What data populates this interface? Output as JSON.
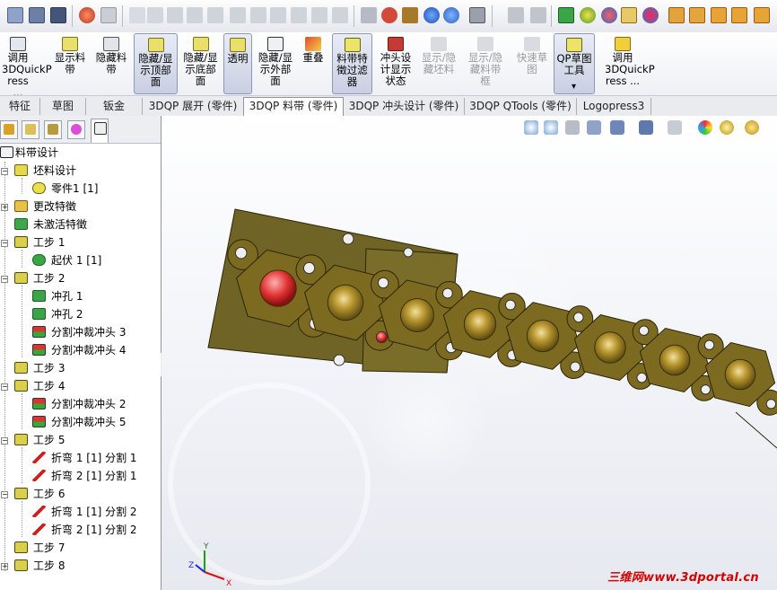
{
  "command_manager": {
    "items": [
      {
        "label": "调用\n3DQuickP\nress ...",
        "state": "normal"
      },
      {
        "label": "显示料\n带",
        "state": "normal"
      },
      {
        "label": "隐藏料\n带",
        "state": "normal"
      },
      {
        "label": "隐藏/显\n示顶部\n面",
        "state": "active"
      },
      {
        "label": "隐藏/显\n示底部\n面",
        "state": "normal"
      },
      {
        "label": "透明",
        "state": "active"
      },
      {
        "label": "隐藏/显\n示外部\n面",
        "state": "normal"
      },
      {
        "label": "重叠",
        "state": "normal"
      },
      {
        "label": "料带特\n徵过滤\n器",
        "state": "active"
      },
      {
        "label": "冲头设\n计显示\n状态",
        "state": "normal"
      },
      {
        "label": "显示/隐\n藏坯料",
        "state": "disabled"
      },
      {
        "label": "显示/隐\n藏料带\n框",
        "state": "disabled"
      },
      {
        "label": "快速草\n图",
        "state": "disabled"
      },
      {
        "label": "QP草图\n工具",
        "state": "active"
      },
      {
        "label": "调用\n3DQuickP\nress ...",
        "state": "normal"
      }
    ],
    "dropdown_arrow": "▾"
  },
  "tabs": [
    "特征",
    "草图",
    "钣金",
    "3DQP 展开 (零件)",
    "3DQP 料带 (零件)",
    "3DQP 冲头设计 (零件)",
    "3DQP QTools (零件)",
    "Logopress3"
  ],
  "active_tab": "3DQP 料带 (零件)",
  "tree": {
    "nodes": [
      {
        "label": "料带设计",
        "icon": "strip-icon"
      },
      {
        "label": "坯料设计",
        "icon": "blank-design-icon"
      },
      {
        "label": "零件1 [1]",
        "icon": "part-icon"
      },
      {
        "label": "更改特徵",
        "icon": "change-feature-icon"
      },
      {
        "label": "未激活特徵",
        "icon": "inactive-feature-icon"
      },
      {
        "label": "工步 1",
        "icon": "step-icon"
      },
      {
        "label": "起伏 1 [1]",
        "icon": "emboss-icon"
      },
      {
        "label": "工步 2",
        "icon": "step-icon"
      },
      {
        "label": "冲孔 1",
        "icon": "pierce-icon"
      },
      {
        "label": "冲孔 2",
        "icon": "pierce-icon"
      },
      {
        "label": "分割冲裁冲头 3",
        "icon": "split-punch-icon"
      },
      {
        "label": "分割冲裁冲头 4",
        "icon": "split-punch-icon"
      },
      {
        "label": "工步 3",
        "icon": "step-icon"
      },
      {
        "label": "工步 4",
        "icon": "step-icon"
      },
      {
        "label": "分割冲裁冲头 2",
        "icon": "split-punch-icon"
      },
      {
        "label": "分割冲裁冲头 5",
        "icon": "split-punch-icon"
      },
      {
        "label": "工步 5",
        "icon": "step-icon"
      },
      {
        "label": "折弯 1 [1] 分割 1",
        "icon": "bend-icon"
      },
      {
        "label": "折弯 2 [1] 分割 1",
        "icon": "bend-icon"
      },
      {
        "label": "工步 6",
        "icon": "step-icon"
      },
      {
        "label": "折弯 1 [1] 分割 2",
        "icon": "bend-icon"
      },
      {
        "label": "折弯 2 [1] 分割 2",
        "icon": "bend-icon"
      },
      {
        "label": "工步 7",
        "icon": "step-icon"
      },
      {
        "label": "工步 8",
        "icon": "step-icon"
      }
    ]
  },
  "viewport": {
    "triad": {
      "x": "X",
      "y": "Y",
      "z": "Z"
    },
    "watermark": "三维网www.3dportal.cn",
    "part_color": "#7b6a1f"
  }
}
